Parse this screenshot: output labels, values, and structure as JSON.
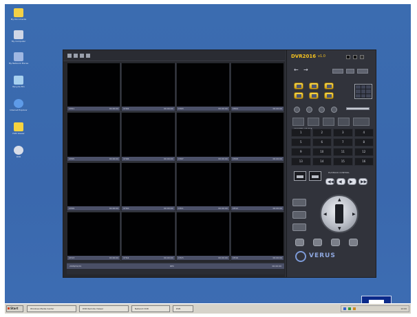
{
  "colors": {
    "desktop": "#3b6cb0",
    "brand_yellow": "#f5c21f",
    "camera_bar": "#4b5068",
    "window_dark": "#2d2f36"
  },
  "desktop": {
    "icons": [
      {
        "label": "My Documents",
        "icon": "folder-icon",
        "color": "#f3d046"
      },
      {
        "label": "My Computer",
        "icon": "computer-icon",
        "color": "#cfd6e6"
      },
      {
        "label": "My Network Places",
        "icon": "network-icon",
        "color": "#9fb7e2"
      },
      {
        "label": "Recycle Bin",
        "icon": "recycle-bin-icon",
        "color": "#a7d0ef"
      },
      {
        "label": "Internet Explorer",
        "icon": "internet-explorer-icon",
        "color": "#5e9be8"
      },
      {
        "label": "DVR Viewer",
        "icon": "folder-icon",
        "color": "#f6d33f"
      },
      {
        "label": "DVR",
        "icon": "application-icon",
        "color": "#d8dde8"
      }
    ]
  },
  "dvr": {
    "brand": "DVR2016",
    "brand_sub": "v1.0",
    "logo": "VERUS",
    "camera_labels": [
      "CH01",
      "CH02",
      "CH03",
      "CH04",
      "CH05",
      "CH06",
      "CH07",
      "CH08",
      "CH09",
      "CH10",
      "CH11",
      "CH12",
      "CH13",
      "CH14",
      "CH15",
      "CH16"
    ],
    "camera_time": "00:00:00",
    "status_left": "2006/01/01",
    "status_mid": "REC",
    "status_right": "00:00:00",
    "keypad": [
      "1",
      "2",
      "3",
      "4",
      "5",
      "6",
      "7",
      "8",
      "9",
      "10",
      "11",
      "12",
      "13",
      "14",
      "15",
      "16"
    ],
    "keypad_caption": "CHANNEL SELECT",
    "seek_caption": "PLAYBACK CONTROL",
    "seek_buttons": [
      "◀◀",
      "◀",
      "▶",
      "▶▶"
    ]
  },
  "taskbar": {
    "start_label": "Start",
    "tasks": [
      "Windows Media Center",
      "DVR Remote Viewer",
      "Network DVR",
      "DVR"
    ],
    "clock": "12:00"
  }
}
